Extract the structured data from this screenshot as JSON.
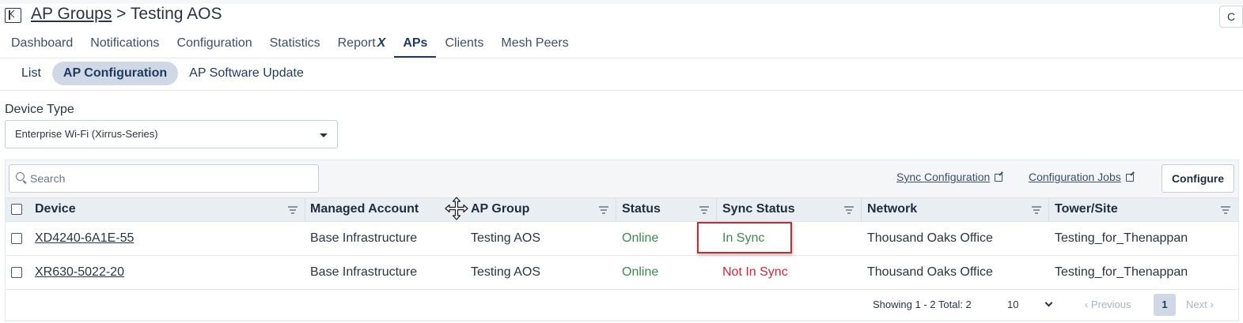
{
  "header": {
    "breadcrumb_parent": "AP Groups",
    "breadcrumb_separator": " > ",
    "breadcrumb_current": "Testing AOS",
    "refresh_icon": "C"
  },
  "tabs": [
    {
      "label": "Dashboard"
    },
    {
      "label": "Notifications"
    },
    {
      "label": "Configuration"
    },
    {
      "label": "Statistics"
    },
    {
      "label": "Report",
      "suffix": "X"
    },
    {
      "label": "APs",
      "active": true
    },
    {
      "label": "Clients"
    },
    {
      "label": "Mesh Peers"
    }
  ],
  "subtabs": [
    {
      "label": "List"
    },
    {
      "label": "AP Configuration",
      "active": true
    },
    {
      "label": "AP Software Update"
    }
  ],
  "device_type": {
    "label": "Device Type",
    "value": "Enterprise Wi-Fi (Xirrus-Series)"
  },
  "toolbar": {
    "search_placeholder": "Search",
    "sync_configuration": "Sync Configuration",
    "configuration_jobs": "Configuration Jobs",
    "configure": "Configure"
  },
  "table": {
    "columns": [
      "Device",
      "Managed Account",
      "AP Group",
      "Status",
      "Sync Status",
      "Network",
      "Tower/Site"
    ],
    "rows": [
      {
        "device": "XD4240-6A1E-55",
        "account": "Base Infrastructure",
        "group": "Testing AOS",
        "status": "Online",
        "sync": "In Sync",
        "network": "Thousand Oaks Office",
        "site": "Testing_for_Thenappan"
      },
      {
        "device": "XR630-5022-20",
        "account": "Base Infrastructure",
        "group": "Testing AOS",
        "status": "Online",
        "sync": "Not In Sync",
        "network": "Thousand Oaks Office",
        "site": "Testing_for_Thenappan"
      }
    ]
  },
  "pagination": {
    "showing": "Showing 1 - 2 Total: 2",
    "page_size": "10",
    "previous": "‹ Previous",
    "current_page": "1",
    "next": "Next ›"
  },
  "colors": {
    "online": "#3e8a4f",
    "not_in_sync": "#c8283c",
    "accent": "#1f3a5f",
    "highlight": "#c42b32"
  }
}
